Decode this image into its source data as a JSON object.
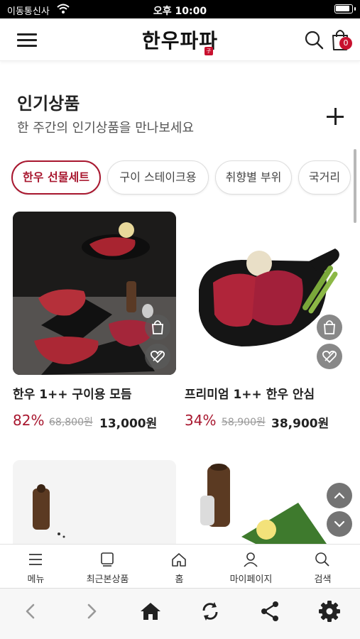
{
  "status_bar": {
    "carrier": "이동통신사",
    "time": "오후 10:00"
  },
  "header": {
    "logo": "한우파파",
    "logo_stamp": "子",
    "cart_count": "0",
    "icons": [
      "menu-icon",
      "search-icon",
      "bag-icon"
    ]
  },
  "section": {
    "title": "인기상품",
    "subtitle": "한 주간의 인기상품을 만나보세요"
  },
  "chips": [
    {
      "label": "한우 선물세트",
      "active": true
    },
    {
      "label": "구이 스테이크용",
      "active": false
    },
    {
      "label": "취향별 부위",
      "active": false
    },
    {
      "label": "국거리",
      "active": false
    }
  ],
  "products": [
    {
      "name": "한우 1++ 구이용 모듬",
      "discount": "82%",
      "original_price": "68,800원",
      "price": "13,000원"
    },
    {
      "name": "프리미엄 1++ 한우 안심",
      "discount": "34%",
      "original_price": "58,900원",
      "price": "38,900원"
    }
  ],
  "bottom_nav": [
    {
      "label": "메뉴",
      "icon": "menu-icon"
    },
    {
      "label": "최근본상품",
      "icon": "recent-icon"
    },
    {
      "label": "홈",
      "icon": "home-icon"
    },
    {
      "label": "마이페이지",
      "icon": "user-icon"
    },
    {
      "label": "검색",
      "icon": "search-icon"
    }
  ],
  "browser_toolbar": [
    "back-icon",
    "forward-icon",
    "home-icon",
    "refresh-icon",
    "share-icon",
    "settings-icon"
  ],
  "colors": {
    "accent": "#a8172f",
    "brand_red": "#c8102e"
  }
}
